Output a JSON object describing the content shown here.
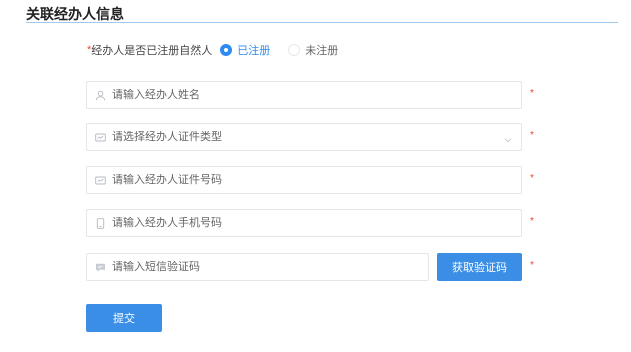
{
  "section": {
    "title": "关联经办人信息"
  },
  "registration": {
    "required_mark": "*",
    "label": "经办人是否已注册自然人",
    "options": [
      {
        "label": "已注册",
        "checked": true
      },
      {
        "label": "未注册",
        "checked": false
      }
    ]
  },
  "fields": {
    "name": {
      "placeholder": "请输入经办人姓名",
      "value": "",
      "icon": "user-icon",
      "required_mark": "*"
    },
    "id_type": {
      "placeholder": "请选择经办人证件类型",
      "value": "",
      "icon": "id-card-icon",
      "required_mark": "*"
    },
    "id_number": {
      "placeholder": "请输入经办人证件号码",
      "value": "",
      "icon": "id-card-icon",
      "required_mark": "*"
    },
    "phone": {
      "placeholder": "请输入经办人手机号码",
      "value": "",
      "icon": "mobile-icon",
      "required_mark": "*"
    },
    "sms_code": {
      "placeholder": "请输入短信验证码",
      "value": "",
      "icon": "message-icon",
      "required_mark": "*"
    }
  },
  "buttons": {
    "get_code": "获取验证码",
    "submit": "提交"
  },
  "colors": {
    "primary": "#3a8ee6",
    "radio_active": "#2d8cf0",
    "required": "#e8482f",
    "title_underline": "#9fc9ee",
    "border": "#e3e6eb"
  }
}
